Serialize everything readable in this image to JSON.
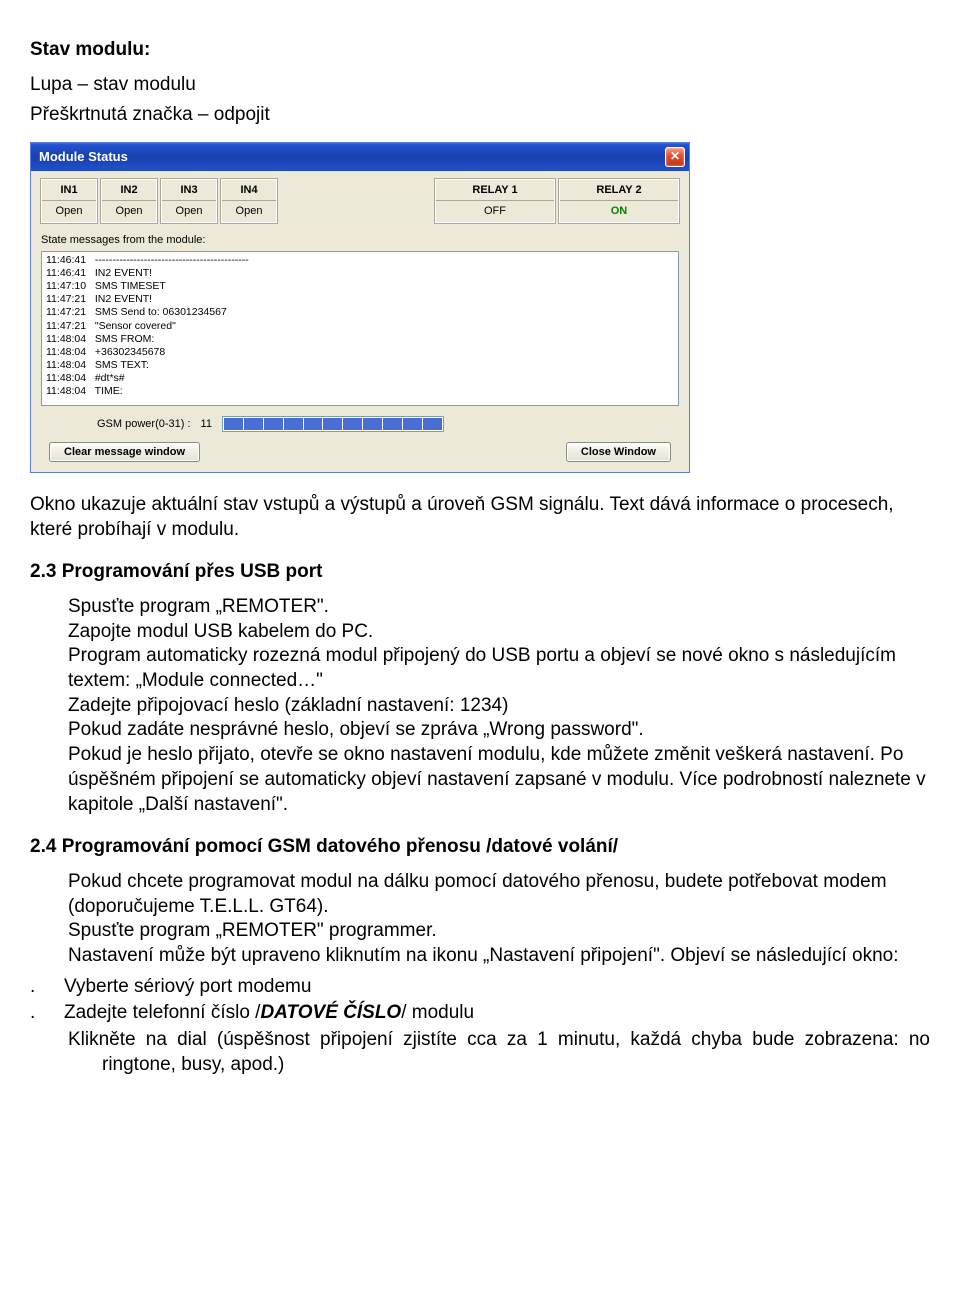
{
  "doc": {
    "h1": "Stav modulu:",
    "intro_l1": "Lupa – stav modulu",
    "intro_l2": "Přeškrtnutá značka – odpojit",
    "after_window": "Okno ukazuje aktuální stav vstupů a výstupů a úroveň GSM signálu. Text dává informace o procesech, které probíhají v modulu.",
    "h2_usb": "2.3 Programování přes USB port",
    "usb_para": "Spusťte program „REMOTER\".\nZapojte modul USB kabelem do PC.\nProgram automaticky rozezná modul připojený do USB portu a objeví se nové okno s následujícím textem:  „Module connected…\"\nZadejte připojovací heslo (základní nastavení: 1234)\nPokud zadáte nesprávné heslo, objeví se zpráva „Wrong password\".\nPokud je heslo přijato, otevře se okno nastavení modulu, kde můžete změnit veškerá nastavení. Po úspěšném připojení se automaticky objeví nastavení zapsané v modulu. Více podrobností naleznete v kapitole „Další nastavení\".",
    "h2_gsm": "2.4 Programování pomocí GSM datového přenosu /datové volání/",
    "gsm_para": "Pokud chcete programovat modul na dálku pomocí datového přenosu, budete potřebovat modem (doporučujeme T.E.L.L. GT64).\nSpusťte program „REMOTER\" programmer.\nNastavení může být upraveno kliknutím na ikonu „Nastavení připojení\". Objeví se následující okno:",
    "item1_marker": ".",
    "item1_text": "Vyberte sériový port modemu",
    "item2_marker": ".",
    "item2_pre": "Zadejte telefonní číslo /",
    "item2_bold": "DATOVÉ ČÍSLO",
    "item2_post": "/ modulu",
    "final_para": "Klikněte na dial (úspěšnost připojení zjistíte cca za 1 minutu, každá chyba bude zobrazena: no ringtone, busy, apod.)"
  },
  "window": {
    "title": "Module Status",
    "close_glyph": "✕",
    "inputs": [
      {
        "label": "IN1",
        "value": "Open"
      },
      {
        "label": "IN2",
        "value": "Open"
      },
      {
        "label": "IN3",
        "value": "Open"
      },
      {
        "label": "IN4",
        "value": "Open"
      }
    ],
    "relays": [
      {
        "label": "RELAY 1",
        "value": "OFF",
        "on": false
      },
      {
        "label": "RELAY 2",
        "value": "ON",
        "on": true
      }
    ],
    "state_label": "State messages from the module:",
    "messages": [
      "11:46:41   --------------------------------------------",
      "11:46:41   IN2 EVENT!",
      "11:47:10   SMS TIMESET",
      "11:47:21   IN2 EVENT!",
      "11:47:21   SMS Send to: 06301234567",
      "11:47:21   \"Sensor covered\"",
      "11:48:04   SMS FROM:",
      "11:48:04   +36302345678",
      "11:48:04   SMS TEXT:",
      "11:48:04   #dt*s#",
      "11:48:04   TIME:"
    ],
    "gsm_label": "GSM power(0-31) :",
    "gsm_value": "11",
    "gsm_segments_total": 11,
    "gsm_segments_filled": 11,
    "btn_clear": "Clear message window",
    "btn_close": "Close Window"
  }
}
